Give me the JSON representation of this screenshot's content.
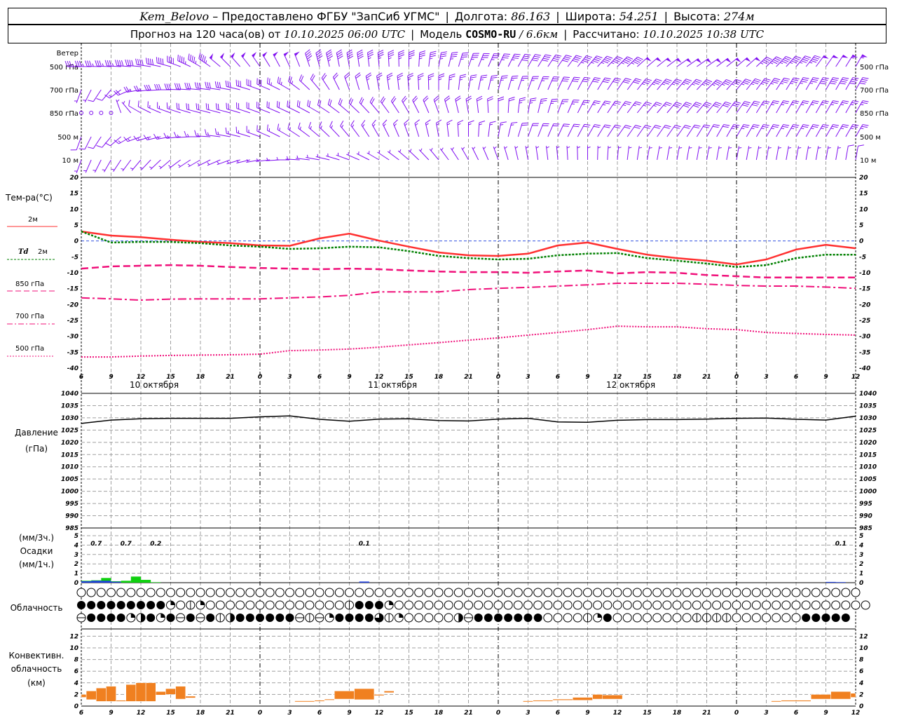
{
  "header": {
    "station": "Kem_Belovo",
    "provider": " – Предоставлено ФГБУ \"ЗапСиб УГМС\"",
    "lon_label": "Долгота:",
    "lon": "86.163",
    "lat_label": "Широта:",
    "lat": "54.251",
    "alt_label": "Высота:",
    "alt": "274м",
    "forecast_label": "Прогноз на 120 часа(ов) от",
    "forecast_time": "10.10.2025 06:00 UTC",
    "model_label": "Модель",
    "model": "COSMO-RU",
    "resolution": "/ 6.6км",
    "computed_label": "Рассчитано:",
    "computed_time": "10.10.2025 10:38 UTC"
  },
  "labels": {
    "wind": "Ветер",
    "levels": [
      "500 гПа",
      "700 гПа",
      "850 гПа",
      "500 м",
      "10 м"
    ],
    "temp_title": "Тем-ра(°C)",
    "legend": [
      "2м",
      "Td",
      "2м",
      "850 гПа",
      "700 гПа",
      "500 гПа"
    ],
    "dates": [
      "10 октября",
      "11 октября",
      "12 октября"
    ],
    "pressure": "Давление",
    "pressure_unit": "(гПа)",
    "precip_3h": "(мм/3ч.)",
    "precip": "Осадки",
    "precip_1h": "(мм/1ч.)",
    "cloud": "Облачность",
    "conv1": "Конвективн.",
    "conv2": "облачность",
    "conv3": "(км)"
  },
  "colors": {
    "wind": "#8010f0",
    "t2m": "#ff3030",
    "td2m": "#008000",
    "upper": "#f0107a",
    "precip_green": "#10d010",
    "precip_blue": "#2040e0",
    "conv": "#f08020",
    "grid": "#a0a0a0"
  },
  "chart_data": {
    "type": "line",
    "hours_span": 78,
    "x_tick_labels": [
      "6",
      "9",
      "12",
      "15",
      "18",
      "21",
      "0",
      "3",
      "6",
      "9",
      "12",
      "15",
      "18",
      "21",
      "0",
      "3",
      "6",
      "9",
      "12",
      "15",
      "18",
      "21",
      "0",
      "3",
      "6",
      "9",
      "12"
    ],
    "temperature": {
      "ylim": [
        -40,
        20
      ],
      "ticks": [
        20,
        15,
        10,
        5,
        0,
        -5,
        -10,
        -15,
        -20,
        -25,
        -30,
        -35,
        -40
      ],
      "series": [
        {
          "name": "2м",
          "values": [
            3.0,
            1.7,
            1.2,
            0.4,
            -0.3,
            -0.7,
            -1.4,
            -1.5,
            0.8,
            2.3,
            0.1,
            -1.8,
            -3.6,
            -4.5,
            -4.7,
            -4.0,
            -1.4,
            -0.5,
            -2.5,
            -4.3,
            -5.4,
            -6.2,
            -7.4,
            -5.8,
            -2.7,
            -1.2,
            -2.3
          ]
        },
        {
          "name": "Td 2м",
          "values": [
            3.0,
            -0.5,
            -0.3,
            -0.3,
            -0.7,
            -1.4,
            -1.8,
            -2.5,
            -2.3,
            -1.8,
            -2.0,
            -3.2,
            -4.7,
            -5.4,
            -5.8,
            -5.6,
            -4.5,
            -4.0,
            -3.8,
            -5.4,
            -6.2,
            -7.1,
            -8.2,
            -7.6,
            -5.4,
            -4.3,
            -4.3
          ]
        },
        {
          "name": "850 гПа",
          "values": [
            -8.7,
            -8.0,
            -7.8,
            -7.6,
            -7.8,
            -8.2,
            -8.5,
            -8.7,
            -8.9,
            -8.7,
            -8.9,
            -9.3,
            -9.6,
            -9.8,
            -9.8,
            -10.0,
            -9.6,
            -9.3,
            -10.2,
            -9.8,
            -10.0,
            -10.7,
            -11.1,
            -11.5,
            -11.5,
            -11.5,
            -11.5
          ]
        },
        {
          "name": "700 гПа",
          "values": [
            -17.9,
            -18.2,
            -18.6,
            -18.3,
            -18.2,
            -18.2,
            -18.2,
            -17.9,
            -17.6,
            -17.1,
            -16.0,
            -16.0,
            -16.0,
            -15.3,
            -14.9,
            -14.6,
            -14.2,
            -13.8,
            -13.3,
            -13.3,
            -13.3,
            -13.6,
            -14.0,
            -14.2,
            -14.2,
            -14.5,
            -14.9
          ]
        },
        {
          "name": "500 гПа",
          "values": [
            -36.5,
            -36.5,
            -36.2,
            -36.0,
            -35.9,
            -35.8,
            -35.6,
            -34.5,
            -34.3,
            -34.0,
            -33.4,
            -32.7,
            -32.0,
            -31.2,
            -30.5,
            -29.6,
            -28.8,
            -27.9,
            -26.8,
            -27.0,
            -27.0,
            -27.6,
            -27.9,
            -28.8,
            -29.1,
            -29.4,
            -29.6
          ]
        }
      ]
    },
    "pressure": {
      "ylim": [
        985,
        1040
      ],
      "ticks": [
        1040,
        1035,
        1030,
        1025,
        1020,
        1015,
        1010,
        1005,
        1000,
        995,
        990,
        985
      ],
      "values": [
        1027.7,
        1029.1,
        1029.6,
        1029.8,
        1029.8,
        1029.8,
        1030.4,
        1030.8,
        1029.4,
        1028.6,
        1029.5,
        1029.6,
        1028.9,
        1028.7,
        1029.5,
        1029.8,
        1028.3,
        1028.2,
        1029.0,
        1029.3,
        1029.3,
        1029.5,
        1029.8,
        1029.9,
        1029.4,
        1029.1,
        1030.7
      ]
    },
    "precipitation": {
      "ylim": [
        0,
        5
      ],
      "ticks": [
        0,
        1,
        2,
        3,
        4,
        5
      ],
      "hourly_total": [
        [
          0,
          0.2
        ],
        [
          1,
          0.25
        ],
        [
          2,
          0.5
        ],
        [
          3,
          0.15
        ],
        [
          4,
          0.2
        ],
        [
          5,
          0.65
        ],
        [
          6,
          0.3
        ],
        [
          7,
          0.05
        ]
      ],
      "hourly_blue": [
        [
          0,
          0.15
        ],
        [
          1,
          0.2
        ],
        [
          2,
          0.2
        ],
        [
          3,
          0.1
        ],
        [
          28,
          0.12
        ],
        [
          75,
          0.08
        ],
        [
          76,
          0.06
        ]
      ],
      "three_hour_totals": [
        [
          "0.7",
          1.5
        ],
        [
          "0.7",
          4.5
        ],
        [
          "0.2",
          7.5
        ],
        [
          "0.1",
          28.5
        ],
        [
          "0.1",
          76.5
        ]
      ]
    },
    "cloud_rows": [
      "ooooooooooooooooooooooooooooooooooooooooooooooooooooooooooooooooooooooooooooooo",
      "fffffffffqohqoooooooooooooohfffqoooooooooooooooooooooooooooooooooooooooooooooooo",
      "cffffqbfqfcfcfhbffffffchcqffffthqooooobcfffffffoooohqfoooooooohhhhooooooofffff"
    ],
    "convective": {
      "ylim": [
        0,
        13
      ],
      "ticks": [
        0,
        2,
        4,
        6,
        8,
        10,
        12
      ],
      "segments": [
        [
          0,
          0.5,
          1.5,
          2.0
        ],
        [
          0.5,
          1.5,
          1.1,
          2.6
        ],
        [
          1.5,
          2.5,
          0.8,
          3.1
        ],
        [
          2.5,
          3.5,
          0.8,
          3.4
        ],
        [
          3.5,
          4.5,
          0.8,
          1.0
        ],
        [
          4.5,
          5.5,
          0.8,
          3.7
        ],
        [
          5.5,
          6.5,
          0.8,
          4.0
        ],
        [
          6.5,
          7.5,
          0.8,
          4.0
        ],
        [
          7.5,
          8.5,
          1.9,
          2.5
        ],
        [
          8.5,
          9.5,
          2.0,
          3.0
        ],
        [
          9.5,
          10.5,
          1.2,
          3.4
        ],
        [
          10.5,
          11.5,
          1.4,
          1.7
        ],
        [
          21.5,
          23.5,
          0.8,
          0.9
        ],
        [
          23.5,
          24.5,
          0.9,
          1.0
        ],
        [
          24.5,
          25.5,
          1.1,
          1.2
        ],
        [
          25.5,
          27.5,
          1.2,
          2.6
        ],
        [
          27.5,
          29.5,
          1.1,
          3.0
        ],
        [
          29.5,
          30.5,
          1.8,
          2.0
        ],
        [
          30.5,
          31.5,
          2.3,
          2.6
        ],
        [
          44.5,
          45.5,
          0.8,
          0.9
        ],
        [
          45.5,
          47.5,
          0.9,
          1.0
        ],
        [
          47.5,
          49.5,
          1.0,
          1.2
        ],
        [
          49.5,
          51.5,
          1.0,
          1.5
        ],
        [
          51.5,
          52.5,
          1.2,
          2.0
        ],
        [
          52.5,
          54.5,
          1.2,
          1.9
        ],
        [
          69.5,
          70.5,
          0.8,
          0.9
        ],
        [
          70.5,
          73.5,
          0.8,
          1.0
        ],
        [
          73.5,
          75.5,
          1.2,
          2.0
        ],
        [
          75.5,
          77.5,
          1.2,
          2.5
        ],
        [
          77.5,
          78,
          1.5,
          2.2
        ]
      ]
    },
    "wind": [
      {
        "level": "500 гПа",
        "dir": [
          270,
          272,
          275,
          285,
          300,
          315,
          325,
          335,
          345,
          350,
          355,
          0,
          10,
          20,
          25,
          30,
          35,
          40,
          45,
          50,
          55,
          55,
          50,
          45,
          40,
          35,
          30
        ],
        "kt": [
          35,
          35,
          40,
          40,
          45,
          50,
          50,
          50,
          45,
          40,
          35,
          35,
          35,
          35,
          35,
          40,
          40,
          45,
          45,
          50,
          50,
          50,
          50,
          45,
          45,
          50,
          55
        ]
      },
      {
        "level": "700 гПа",
        "dir": [
          200,
          220,
          260,
          270,
          275,
          280,
          290,
          300,
          320,
          340,
          350,
          355,
          0,
          10,
          15,
          20,
          25,
          30,
          35,
          40,
          40,
          45,
          40,
          35,
          30,
          30,
          30
        ],
        "kt": [
          5,
          10,
          25,
          30,
          30,
          30,
          30,
          25,
          20,
          20,
          25,
          25,
          25,
          25,
          25,
          25,
          30,
          30,
          30,
          35,
          35,
          35,
          35,
          35,
          35,
          40,
          40
        ]
      },
      {
        "level": "850 гПа",
        "dir": [
          0,
          0,
          300,
          290,
          285,
          285,
          290,
          295,
          300,
          310,
          320,
          330,
          340,
          350,
          0,
          10,
          20,
          30,
          35,
          40,
          40,
          40,
          35,
          30,
          30,
          30,
          30
        ],
        "kt": [
          0,
          0,
          10,
          15,
          20,
          20,
          20,
          20,
          20,
          20,
          20,
          20,
          20,
          20,
          20,
          25,
          25,
          25,
          25,
          25,
          30,
          30,
          30,
          25,
          25,
          25,
          25
        ]
      },
      {
        "level": "500 м",
        "dir": [
          200,
          220,
          250,
          260,
          270,
          280,
          290,
          300,
          310,
          320,
          330,
          340,
          350,
          0,
          10,
          20,
          25,
          30,
          35,
          35,
          35,
          30,
          30,
          30,
          30,
          30,
          30
        ],
        "kt": [
          10,
          10,
          15,
          15,
          15,
          15,
          15,
          15,
          15,
          15,
          15,
          15,
          15,
          15,
          15,
          20,
          20,
          20,
          20,
          20,
          20,
          20,
          25,
          25,
          25,
          25,
          25
        ]
      },
      {
        "level": "10 м",
        "dir": [
          200,
          210,
          220,
          230,
          240,
          250,
          260,
          270,
          280,
          290,
          300,
          310,
          320,
          330,
          340,
          350,
          355,
          0,
          5,
          10,
          10,
          10,
          10,
          10,
          10,
          10,
          10
        ],
        "kt": [
          5,
          5,
          5,
          5,
          5,
          5,
          5,
          5,
          5,
          5,
          5,
          5,
          5,
          5,
          5,
          5,
          5,
          5,
          5,
          5,
          5,
          5,
          5,
          5,
          5,
          5,
          10
        ]
      }
    ]
  }
}
